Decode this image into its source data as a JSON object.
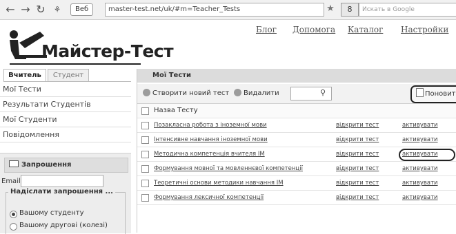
{
  "browser": {
    "site_badge": "Веб",
    "url": "master-test.net/uk/#m=Teacher_Tests",
    "search_placeholder": "Искать в Google",
    "engine_letter": "8"
  },
  "logo": {
    "text": "Майстер-Тест"
  },
  "top_links": [
    "Блог",
    "Допомога",
    "Каталог",
    "Настройки"
  ],
  "sidebar": {
    "tabs": [
      "Вчитель",
      "Студент"
    ],
    "active_tab": 0,
    "items": [
      "Мої Тести",
      "Результати Студентів",
      "Мої Студенти",
      "Повідомлення"
    ],
    "invite": {
      "title": "Запрошення",
      "email_label": "Email:",
      "send_legend": "Надіслати запрошення ...",
      "radio_options": [
        "Вашому студенту",
        "Вашому другові (колезі)"
      ],
      "selected": 0
    }
  },
  "main": {
    "title": "Мої Тести",
    "toolbar": {
      "create_label": "Створити новий тест",
      "delete_label": "Видалити",
      "share_label": "Поновити"
    },
    "table": {
      "header_name": "Назва Тесту",
      "rows": [
        {
          "name": "Позакласна робота з іноземної мови",
          "open": "відкрити тест",
          "action": "активувати"
        },
        {
          "name": "Інтенсивне навчання іноземної мови",
          "open": "відкрити тест",
          "action": "активувати"
        },
        {
          "name": "Методична компетенція вчителя ІМ",
          "open": "відкрити тест",
          "action": "активувати"
        },
        {
          "name": "Формування мовної та мовленнєвої компетенції",
          "open": "відкрити тест",
          "action": "активувати"
        },
        {
          "name": "Теоретичні основи методики навчання ІМ",
          "open": "відкрити тест",
          "action": "активувати"
        },
        {
          "name": "Формування лексичної компетенції",
          "open": "відкрити тест",
          "action": "активувати"
        }
      ]
    }
  }
}
